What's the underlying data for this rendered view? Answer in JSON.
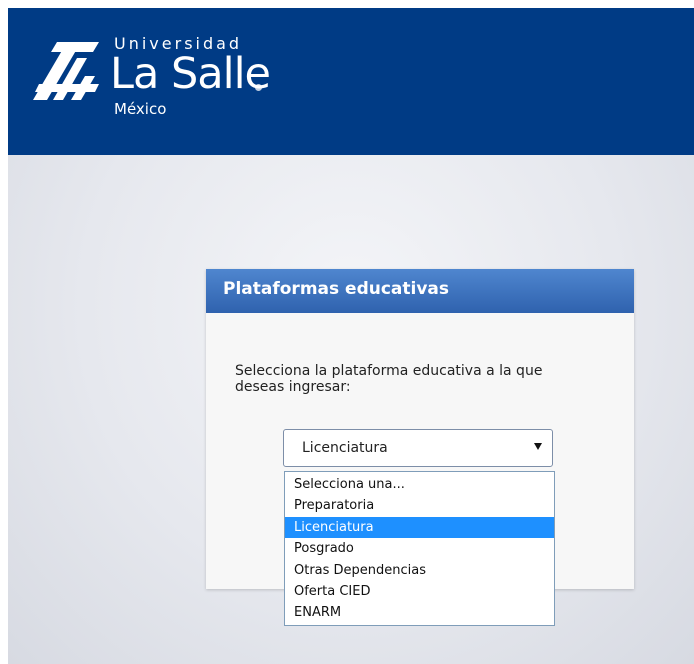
{
  "header": {
    "logo_universidad": "Universidad",
    "logo_lasalle": "La Salle",
    "logo_mexico": "México",
    "color": "#003b85"
  },
  "card": {
    "title": "Plataformas educativas",
    "prompt": "Selecciona la plataforma educativa a la que deseas ingresar:",
    "header_color": "#3a6fbf"
  },
  "select": {
    "value": "Licenciatura",
    "options": [
      "Selecciona una...",
      "Preparatoria",
      "Licenciatura",
      "Posgrado",
      "Otras Dependencias",
      "Oferta CIED",
      "ENARM"
    ],
    "highlight_color": "#1e90ff"
  }
}
